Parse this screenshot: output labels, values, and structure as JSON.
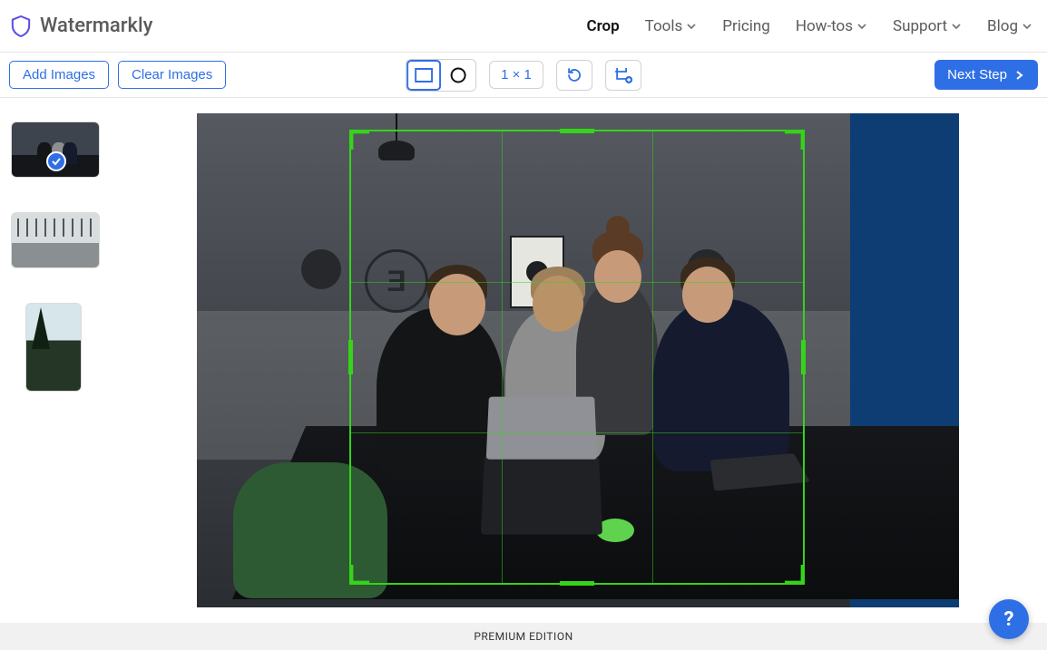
{
  "brand": {
    "name": "Watermarkly"
  },
  "nav": {
    "crop": "Crop",
    "tools": "Tools",
    "pricing": "Pricing",
    "howtos": "How-tos",
    "support": "Support",
    "blog": "Blog"
  },
  "toolbar": {
    "add_images": "Add Images",
    "clear_images": "Clear Images",
    "aspect_ratio": "1 × 1",
    "next_step": "Next Step"
  },
  "footer": {
    "edition": "PREMIUM EDITION"
  },
  "help": {
    "label": "?"
  },
  "thumbnails": [
    {
      "alt": "People around laptop in office",
      "selected": true
    },
    {
      "alt": "Open office / warehouse interior",
      "selected": false
    },
    {
      "alt": "Person by trees at sunset",
      "selected": false
    }
  ]
}
